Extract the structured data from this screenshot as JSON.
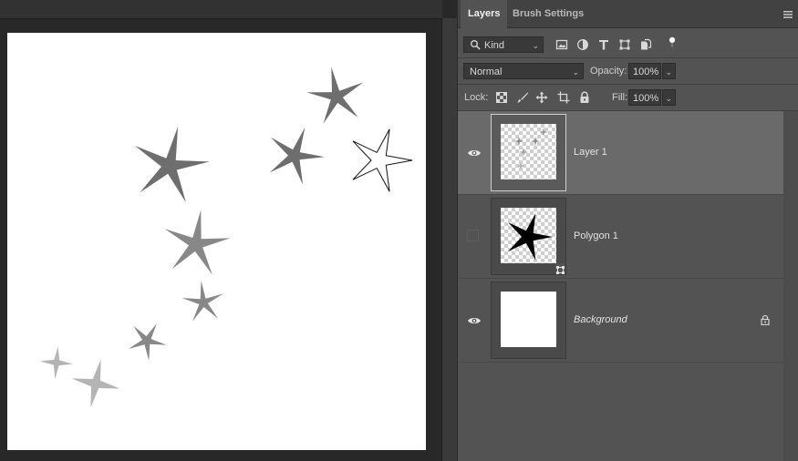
{
  "panel": {
    "tabs": [
      {
        "label": "Layers",
        "active": true
      },
      {
        "label": "Brush Settings",
        "active": false
      }
    ],
    "filter": {
      "kind_label": "Kind"
    },
    "blend": {
      "mode": "Normal",
      "opacity_label": "Opacity:",
      "opacity_value": "100%"
    },
    "lock": {
      "lock_label": "Lock:",
      "fill_label": "Fill:",
      "fill_value": "100%"
    },
    "layers": [
      {
        "name": "Layer 1",
        "visible": true,
        "selected": true,
        "italic": false,
        "locked": false
      },
      {
        "name": "Polygon 1",
        "visible": false,
        "selected": false,
        "italic": false,
        "locked": false
      },
      {
        "name": "Background",
        "visible": true,
        "selected": false,
        "italic": true,
        "locked": true
      }
    ]
  },
  "icons": {
    "search": "magnifier-icon",
    "filter_pixel": "image-filter-icon",
    "filter_adjust": "adjustment-filter-icon",
    "filter_type": "type-filter-icon",
    "filter_shape": "shape-filter-icon",
    "filter_smart": "smart-object-filter-icon",
    "filter_toggle": "filter-toggle-icon",
    "lock_transparent": "lock-transparent-pixels-icon",
    "lock_paint": "lock-image-pixels-icon",
    "lock_position": "lock-position-icon",
    "lock_artboard": "lock-artboard-icon",
    "lock_all": "lock-all-icon",
    "visibility": "eye-icon",
    "panel_menu": "panel-menu-icon"
  },
  "colors": {
    "canvas_bg": "#282828",
    "panel_bg": "#535353",
    "selected_layer": "#6a6a6a",
    "star_dark": "#6e6e6e",
    "star_mid": "#888888",
    "star_light": "#b4b4b4"
  },
  "canvas": {
    "stars": [
      {
        "id": "star-outline",
        "tone": "outline"
      },
      {
        "id": "star-1",
        "tone": "dark"
      },
      {
        "id": "star-2",
        "tone": "dark"
      },
      {
        "id": "star-3",
        "tone": "dark"
      },
      {
        "id": "star-4",
        "tone": "mid"
      },
      {
        "id": "star-5",
        "tone": "mid"
      },
      {
        "id": "star-6",
        "tone": "mid"
      },
      {
        "id": "star-7",
        "tone": "light"
      },
      {
        "id": "star-8",
        "tone": "light"
      }
    ]
  }
}
